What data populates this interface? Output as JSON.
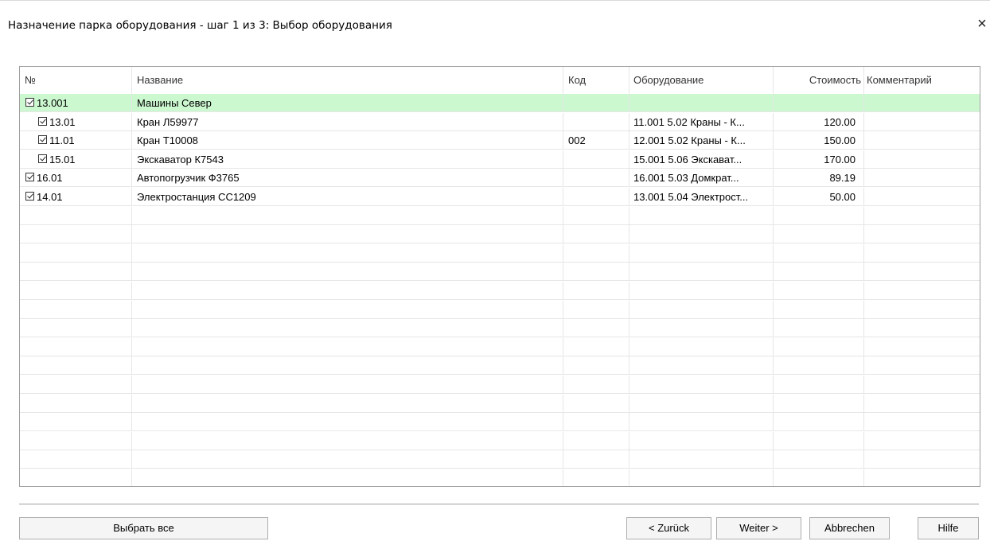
{
  "dialog": {
    "title": "Назначение парка оборудования - шаг 1 из 3: Выбор оборудования",
    "close_glyph": "×"
  },
  "table": {
    "columns": [
      "№",
      "Название",
      "Код",
      "Оборудование",
      "Стоимость",
      "Комментарий"
    ],
    "rows": [
      {
        "num": "13.001",
        "name": "Машины Север",
        "code": "",
        "equipment": "",
        "cost": "",
        "comment": "",
        "checked": true,
        "level": 0,
        "selected": true
      },
      {
        "num": "13.01",
        "name": "Кран Л59977",
        "code": "",
        "equipment": "11.001 5.02 Краны - К...",
        "cost": "120.00",
        "comment": "",
        "checked": true,
        "level": 1,
        "selected": false
      },
      {
        "num": "11.01",
        "name": "Кран Т10008",
        "code": "002",
        "equipment": "12.001 5.02 Краны - К...",
        "cost": "150.00",
        "comment": "",
        "checked": true,
        "level": 1,
        "selected": false
      },
      {
        "num": "15.01",
        "name": "Экскаватор К7543",
        "code": "",
        "equipment": "15.001 5.06 Экскават...",
        "cost": "170.00",
        "comment": "",
        "checked": true,
        "level": 1,
        "selected": false
      },
      {
        "num": "16.01",
        "name": "Автопогрузчик Ф3765",
        "code": "",
        "equipment": "16.001 5.03 Домкрат...",
        "cost": "89.19",
        "comment": "",
        "checked": true,
        "level": 0,
        "selected": false
      },
      {
        "num": "14.01",
        "name": "Электростанция СС1209",
        "code": "",
        "equipment": "13.001 5.04 Электрост...",
        "cost": "50.00",
        "comment": "",
        "checked": true,
        "level": 0,
        "selected": false
      }
    ]
  },
  "buttons": {
    "select_all": "Выбрать все",
    "back": "< Zurück",
    "next": "Weiter >",
    "cancel": "Abbrechen",
    "help": "Hilfe"
  },
  "colors": {
    "selected_row": "#ccf8d0",
    "grid_line": "#e6e6e6",
    "border": "#a0a0a0"
  }
}
